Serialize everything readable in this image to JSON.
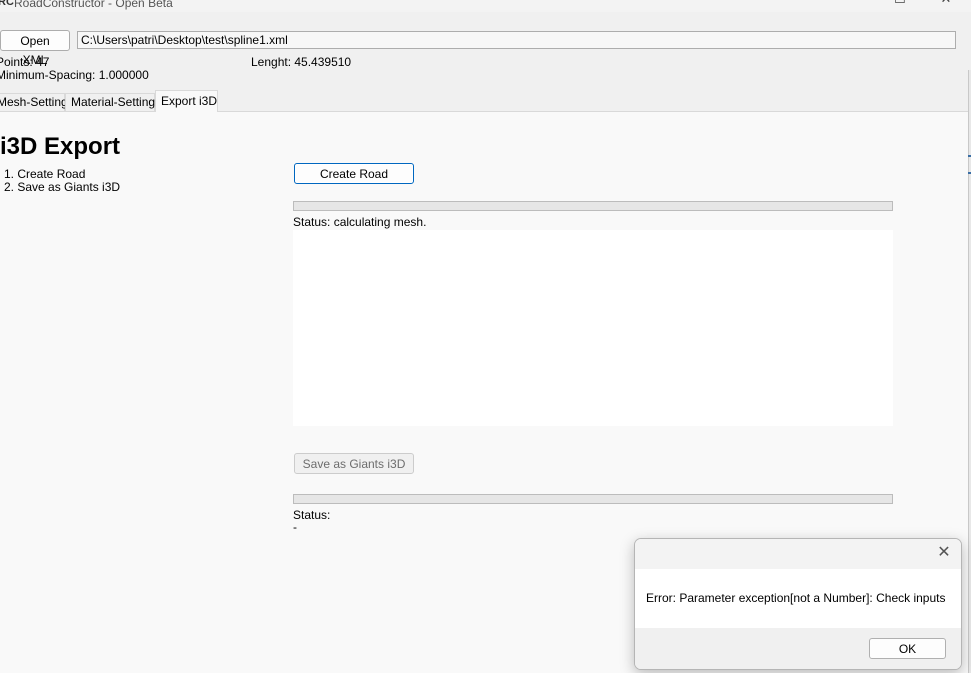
{
  "window": {
    "title": "RoadConstructor - Open Beta",
    "app_icon": "RC",
    "minimize_icon": "minimize-icon",
    "maximize_icon": "maximize-icon",
    "close_icon": "close-icon"
  },
  "toolbar": {
    "open_xml_label": "Open XML",
    "file_path": "C:\\Users\\patri\\Desktop\\test\\spline1.xml"
  },
  "info": {
    "points": "Points: 47",
    "minimum_spacing": "Minimum-Spacing: 1.000000",
    "length": "Lenght: 45.439510"
  },
  "tabs": [
    {
      "label": "Mesh-Settings"
    },
    {
      "label": "Material-Settings"
    },
    {
      "label": "Export i3D",
      "active": true
    }
  ],
  "export": {
    "heading": "i3D Export",
    "steps": [
      "1. Create Road",
      "2. Save as Giants i3D"
    ],
    "create_road_label": "Create Road",
    "create_progress": 0,
    "create_status": "Status: calculating mesh.",
    "save_label": "Save as Giants i3D",
    "save_progress": 0,
    "save_status": "Status:",
    "save_status_detail": "-"
  },
  "dialog": {
    "message": "Error: Parameter exception[not a Number]: Check inputs",
    "ok_label": "OK",
    "close_icon": "close-icon"
  },
  "colors": {
    "accent": "#0067c0",
    "progress_fill": "#06b025"
  }
}
